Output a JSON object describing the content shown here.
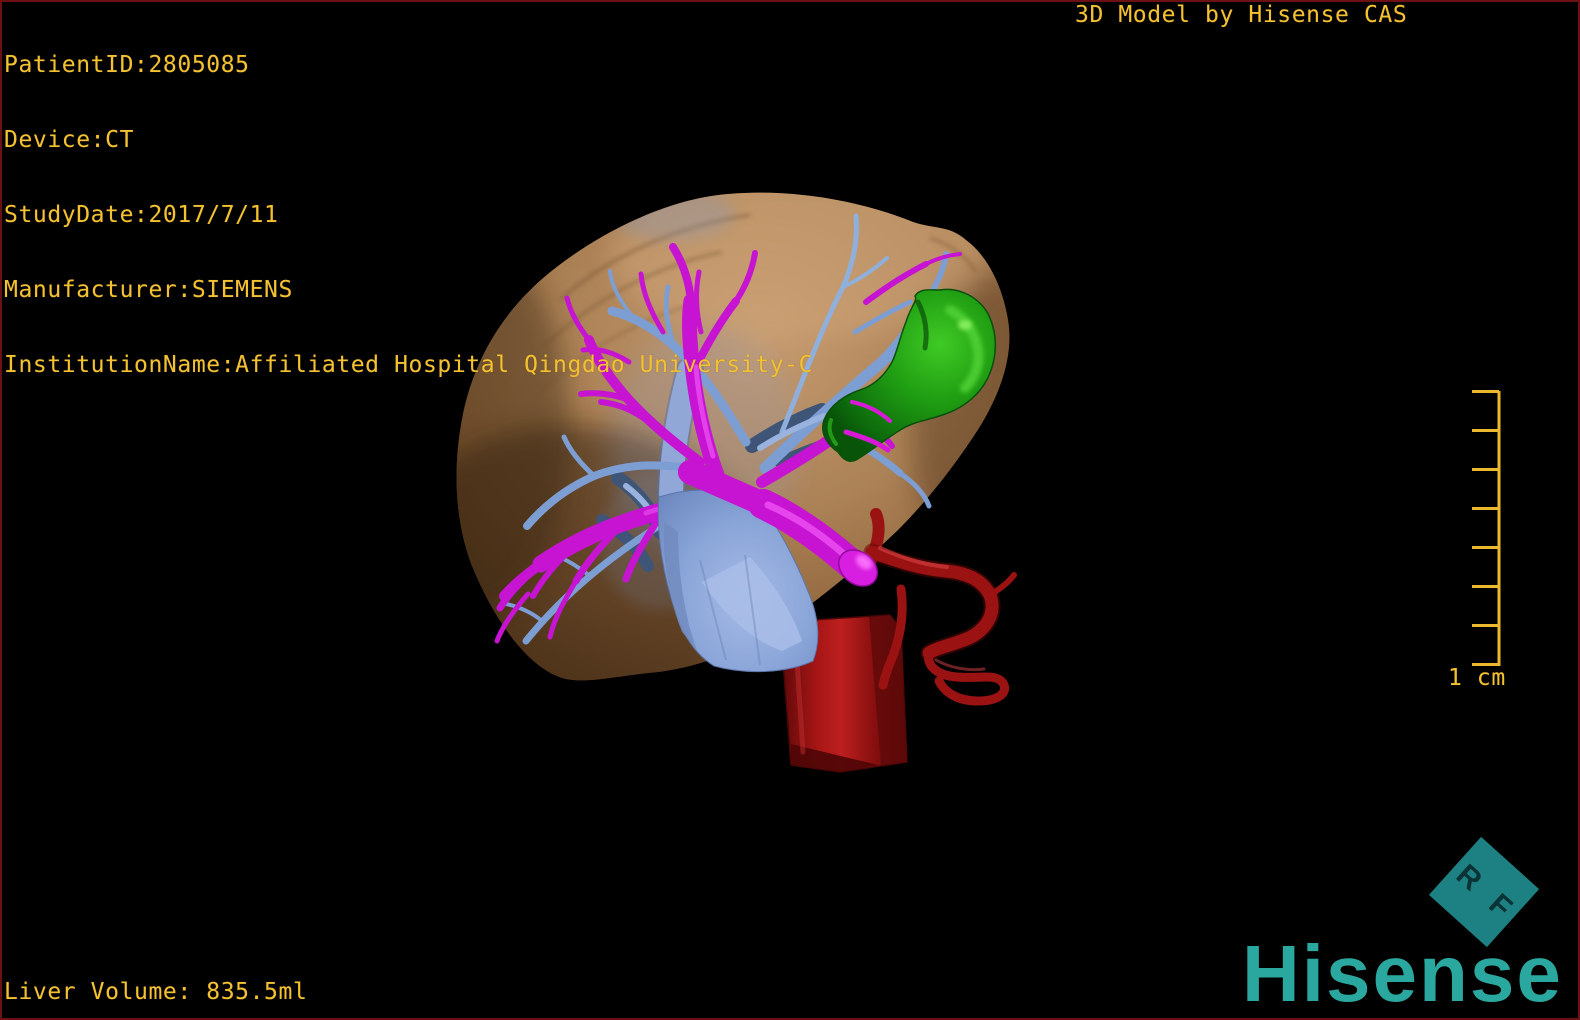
{
  "window": {
    "background": "#000000",
    "border_color": "#6b1114"
  },
  "annotations": {
    "text_color": "#f2c232",
    "patient_info": {
      "patient_id": "PatientID:2805085",
      "device": "Device:CT",
      "study_date": "StudyDate:2017/7/11",
      "manufacturer": "Manufacturer:SIEMENS",
      "institution": "InstitutionName:Affiliated Hospital Qingdao University-C"
    },
    "title": "3D Model by Hisense CAS",
    "liver_volume": "Liver Volume: 835.5ml",
    "scale_label": "1 cm"
  },
  "branding": {
    "wordmark": "Hisense",
    "badge_text": "R F",
    "wordmark_color": "#2aa79e",
    "badge_color": "#1d8083"
  },
  "model": {
    "structures": [
      {
        "label": "liver",
        "color": "#a97e52"
      },
      {
        "label": "portal-vein",
        "color": "#c713d2"
      },
      {
        "label": "hepatic-veins",
        "color": "#7d9ed3"
      },
      {
        "label": "inferior-vena-cava",
        "color": "#8aa5d8"
      },
      {
        "label": "artery-aorta",
        "color": "#9a1212"
      },
      {
        "label": "gallbladder",
        "color": "#1f9c12"
      }
    ]
  }
}
